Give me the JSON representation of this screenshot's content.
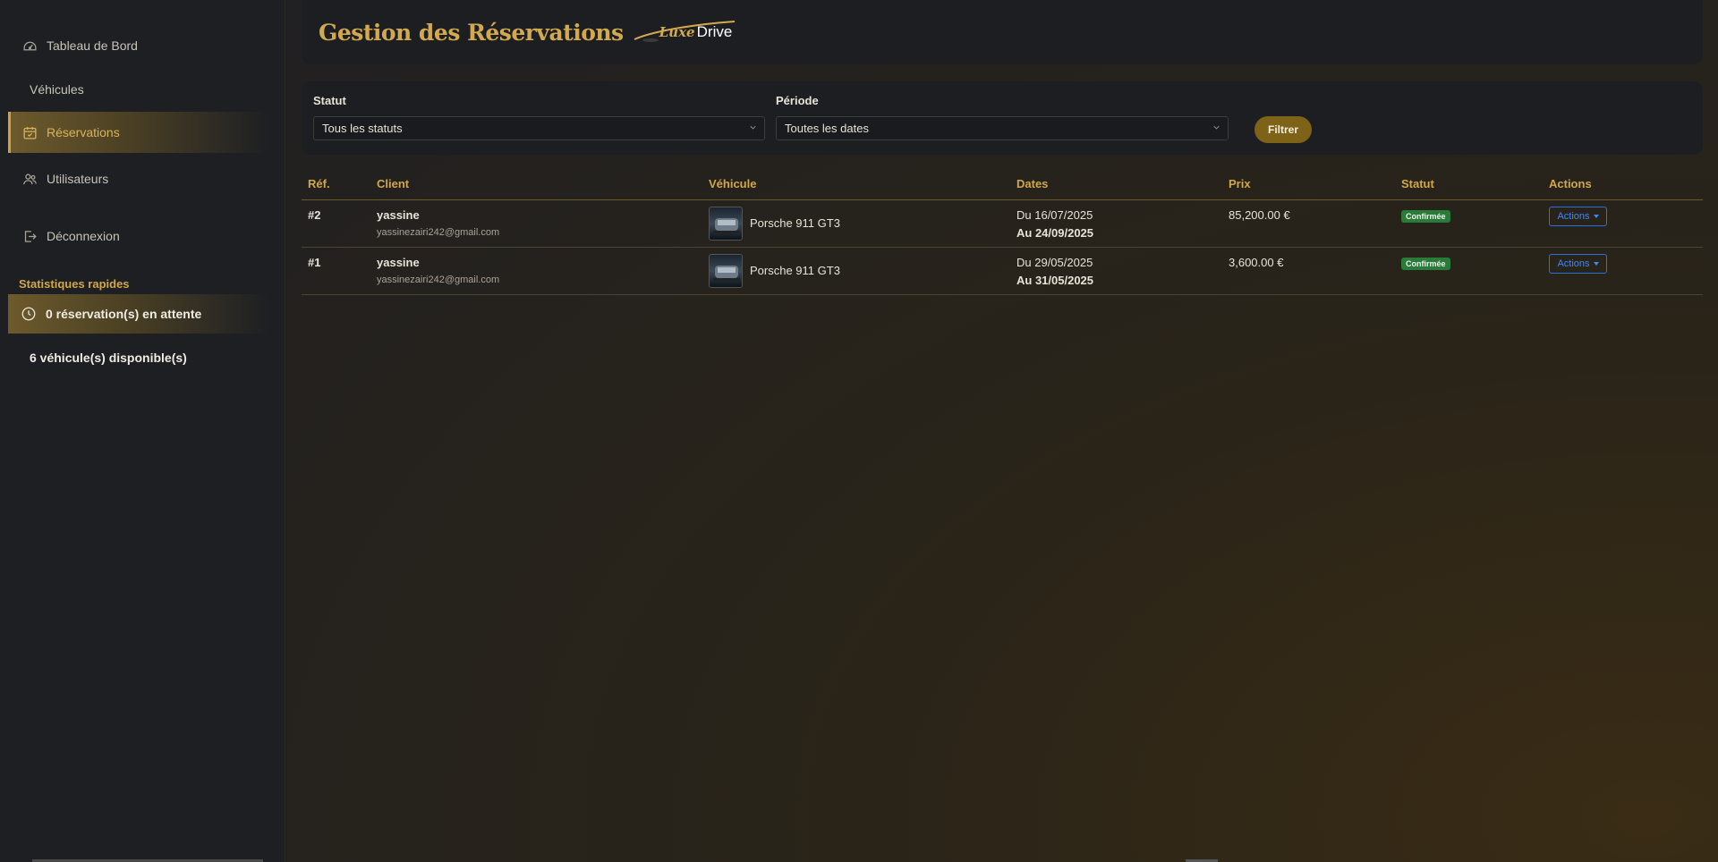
{
  "sidebar": {
    "nav": [
      {
        "label": "Tableau de Bord",
        "icon": "dashboard-gauge-icon"
      },
      {
        "label": "Véhicules",
        "icon": ""
      },
      {
        "label": "Réservations",
        "icon": "calendar-check-icon",
        "active": true
      },
      {
        "label": "Utilisateurs",
        "icon": "users-icon"
      },
      {
        "label": "Déconnexion",
        "icon": "logout-icon"
      }
    ],
    "stats_title": "Statistiques rapides",
    "stats": [
      {
        "label": "0 réservation(s) en attente",
        "icon": "clock-icon"
      },
      {
        "label": "6 véhicule(s) disponible(s)",
        "icon": ""
      }
    ]
  },
  "header": {
    "title": "Gestion des Réservations",
    "logo": {
      "part1": "Luxe",
      "part2": "Drive"
    }
  },
  "filters": {
    "status_label": "Statut",
    "status_value": "Tous les statuts",
    "period_label": "Période",
    "period_value": "Toutes les dates",
    "button": "Filtrer"
  },
  "table": {
    "headers": [
      "Réf.",
      "Client",
      "Véhicule",
      "Dates",
      "Prix",
      "Statut",
      "Actions"
    ],
    "rows": [
      {
        "ref": "#2",
        "client_name": "yassine",
        "client_email": "yassinezairi242@gmail.com",
        "vehicle": "Porsche 911 GT3",
        "date_from": "Du 16/07/2025",
        "date_to": "Au 24/09/2025",
        "price": "85,200.00 €",
        "status": "Confirmée",
        "action": "Actions"
      },
      {
        "ref": "#1",
        "client_name": "yassine",
        "client_email": "yassinezairi242@gmail.com",
        "vehicle": "Porsche 911 GT3",
        "date_from": "Du 29/05/2025",
        "date_to": "Au 31/05/2025",
        "price": "3,600.00 €",
        "status": "Confirmée",
        "action": "Actions"
      }
    ]
  },
  "colors": {
    "accent": "#d1a74a",
    "status_confirmed": "#2a7a3a",
    "actions_blue": "#3e86ff"
  }
}
